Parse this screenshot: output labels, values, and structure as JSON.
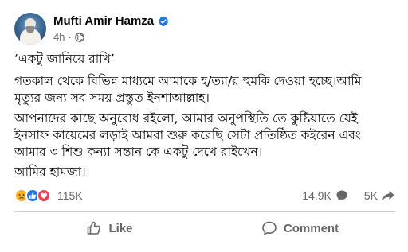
{
  "post": {
    "author": "Mufti Amir Hamza",
    "time": "4h",
    "separator": "·",
    "icons": {
      "verified": "verified-badge-icon",
      "audience": "globe-icon"
    },
    "paragraphs": [
      [
        "‘একটু জানিয়ে রাখি’"
      ],
      [
        "গতকাল থেকে বিভিন্ন মাধ্যমে আমাকে হ/ত্যা/র হুমকি দেওয়া হচ্ছে।আমি",
        "মৃত্যুর জন্য সব সময় প্রস্তুত ইনশাআল্লাহ।"
      ],
      [
        "আপনাদের কাছে অনুরোধ রইলো, আমার অনুপস্থিতি তে কুষ্টিয়াতে যেই",
        "ইনসাফ কায়েমের লড়াই আমরা শুরু করেছি সেটা প্রতিষ্ঠিত কইরেন এবং",
        "আমার ৩ শিশু কন্যা সন্তান কে একটু দেখে রাইখেন।"
      ],
      [
        "আমির হামজা।"
      ]
    ]
  },
  "stats": {
    "reactions": [
      "sad-reaction-icon",
      "like-reaction-icon",
      "love-reaction-icon"
    ],
    "reaction_count": "115K",
    "comment_count": "14.9K",
    "share_count": "5K"
  },
  "actions": {
    "like_label": "Like",
    "comment_label": "Comment"
  },
  "colors": {
    "text": "#050505",
    "secondary": "#65676b",
    "brand_blue": "#1877f2",
    "love_red": "#f33e58",
    "sad_yellow": "#f7b125",
    "divider": "#ced0d4"
  }
}
